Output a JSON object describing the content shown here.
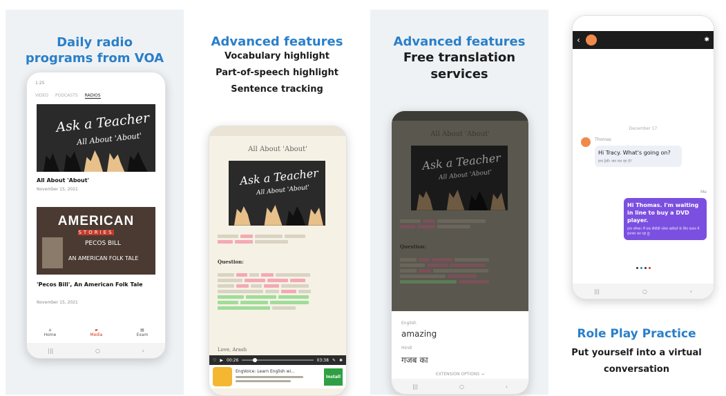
{
  "panel1": {
    "heading": "Daily radio\nprograms from VOA",
    "status_time": "1:25",
    "tabs": [
      "VIDEO",
      "PODCASTS",
      "RADIOS"
    ],
    "item1": {
      "board_title": "Ask a Teacher",
      "board_sub": "All About 'About'",
      "title": "All About 'About'",
      "date": "November 15, 2021"
    },
    "item2": {
      "banner_title": "AMERICAN",
      "banner_sub": "STORIES",
      "banner_name": "PECOS BILL",
      "banner_tag": "AN AMERICAN FOLK TALE",
      "title": "'Pecos Bill', An American Folk Tale",
      "date": "November 15, 2021"
    },
    "nav": [
      {
        "label": "Home"
      },
      {
        "label": "Media"
      },
      {
        "label": "Exam"
      }
    ]
  },
  "panel2": {
    "heading": "Advanced features",
    "lines": [
      "Vocabulary highlight",
      "Part-of-speech highlight",
      "Sentence tracking"
    ],
    "article_title": "All About 'About'",
    "board_title": "Ask a Teacher",
    "board_sub": "All About 'About'",
    "question_label": "Question:",
    "section_label": "Love, Arash",
    "player_time_left": "00:26",
    "player_time_right": "03:38",
    "ad_title": "EngVoice: Learn English wi...",
    "ad_button": "Install"
  },
  "panel3": {
    "heading_blue": "Advanced features",
    "heading_black": "Free translation\nservices",
    "article_title": "All About 'About'",
    "board_title": "Ask a Teacher",
    "board_sub": "All About 'About'",
    "question_label": "Question:",
    "lang_from": "English",
    "word": "amazing",
    "lang_to": "Hindi",
    "translation": "गजब का",
    "ext_button": "EXTENSION OPTIONS →"
  },
  "panel4": {
    "date": "December 17",
    "sender": "Thomas",
    "msg_in": "Hi Tracy. What's going on?",
    "msg_in_tr": "हाय ट्रेसी। क्या चल रहा है?",
    "me_label": "Me",
    "msg_out": "Hi Thomas. I'm waiting in line to buy a DVD player.",
    "msg_out_tr": "हाय थॉमस। मैं एक डीवीडी प्लेयर खरीदने के लिए कतार में इंतजार कर रहा हूं।",
    "heading_blue": "Role Play Practice",
    "heading_black": "Put yourself into a virtual\nconversation"
  },
  "colors": {
    "accent_blue": "#2a7fc9",
    "purple": "#7b4fe0",
    "red_nav": "#d9322b",
    "chalk": "#2a2a2a"
  }
}
